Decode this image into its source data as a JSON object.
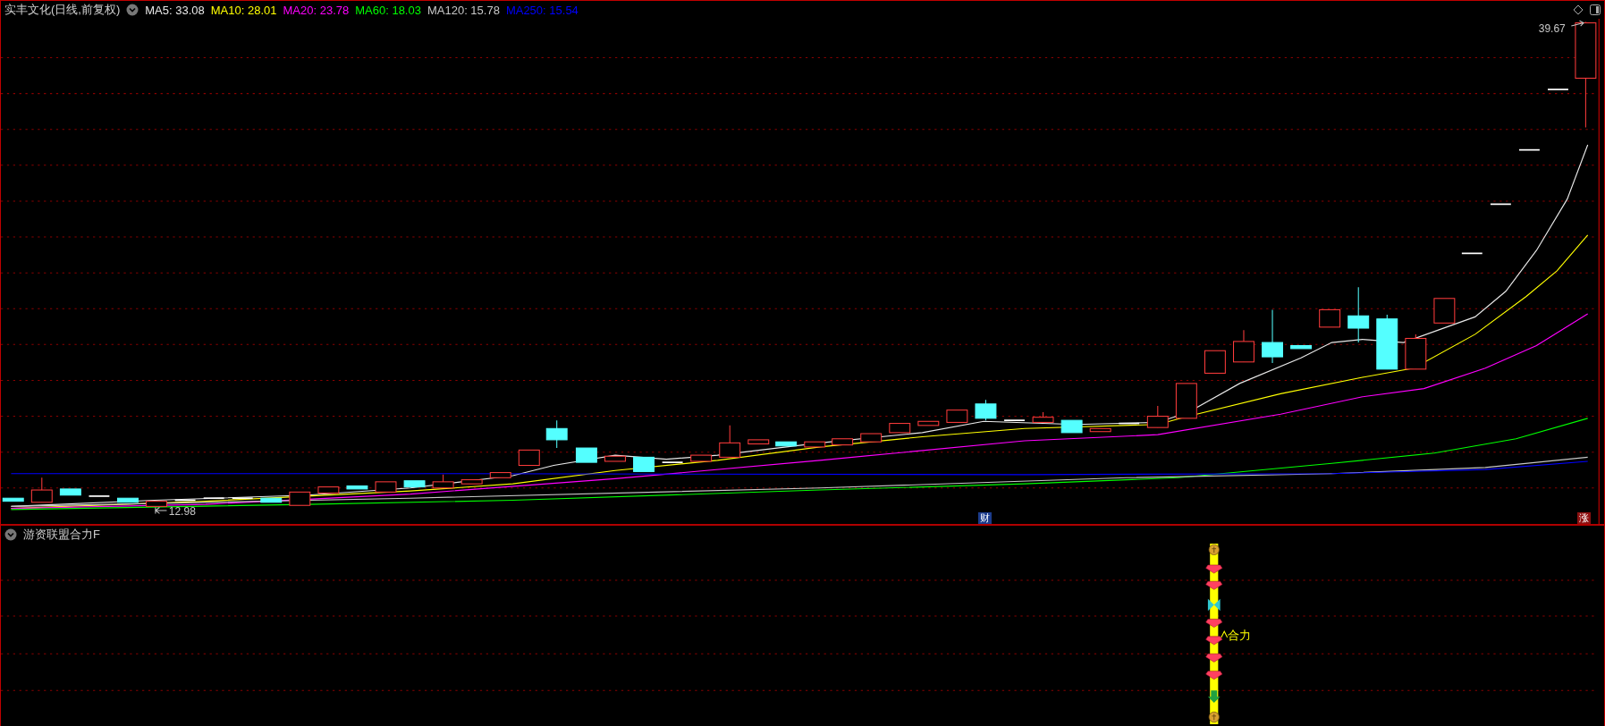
{
  "chart": {
    "title": "实丰文化(日线,前复权)",
    "indicators": [
      {
        "label": "MA5: 33.08",
        "color": "#e8e8e8"
      },
      {
        "label": "MA10: 28.01",
        "color": "#ffff00"
      },
      {
        "label": "MA20: 23.78",
        "color": "#ff00ff"
      },
      {
        "label": "MA60: 18.03",
        "color": "#00ff00"
      },
      {
        "label": "MA120: 15.78",
        "color": "#c8c8c8"
      },
      {
        "label": "MA250: 15.54",
        "color": "#0000ff"
      }
    ],
    "high_label": "39.67",
    "low_label": "12.98",
    "markers": [
      {
        "label": "财",
        "kind": "finance"
      },
      {
        "label": "涨",
        "kind": "limit"
      }
    ]
  },
  "indicator_panel": {
    "title": "游资联盟合力F",
    "signal_label": "合力"
  }
}
